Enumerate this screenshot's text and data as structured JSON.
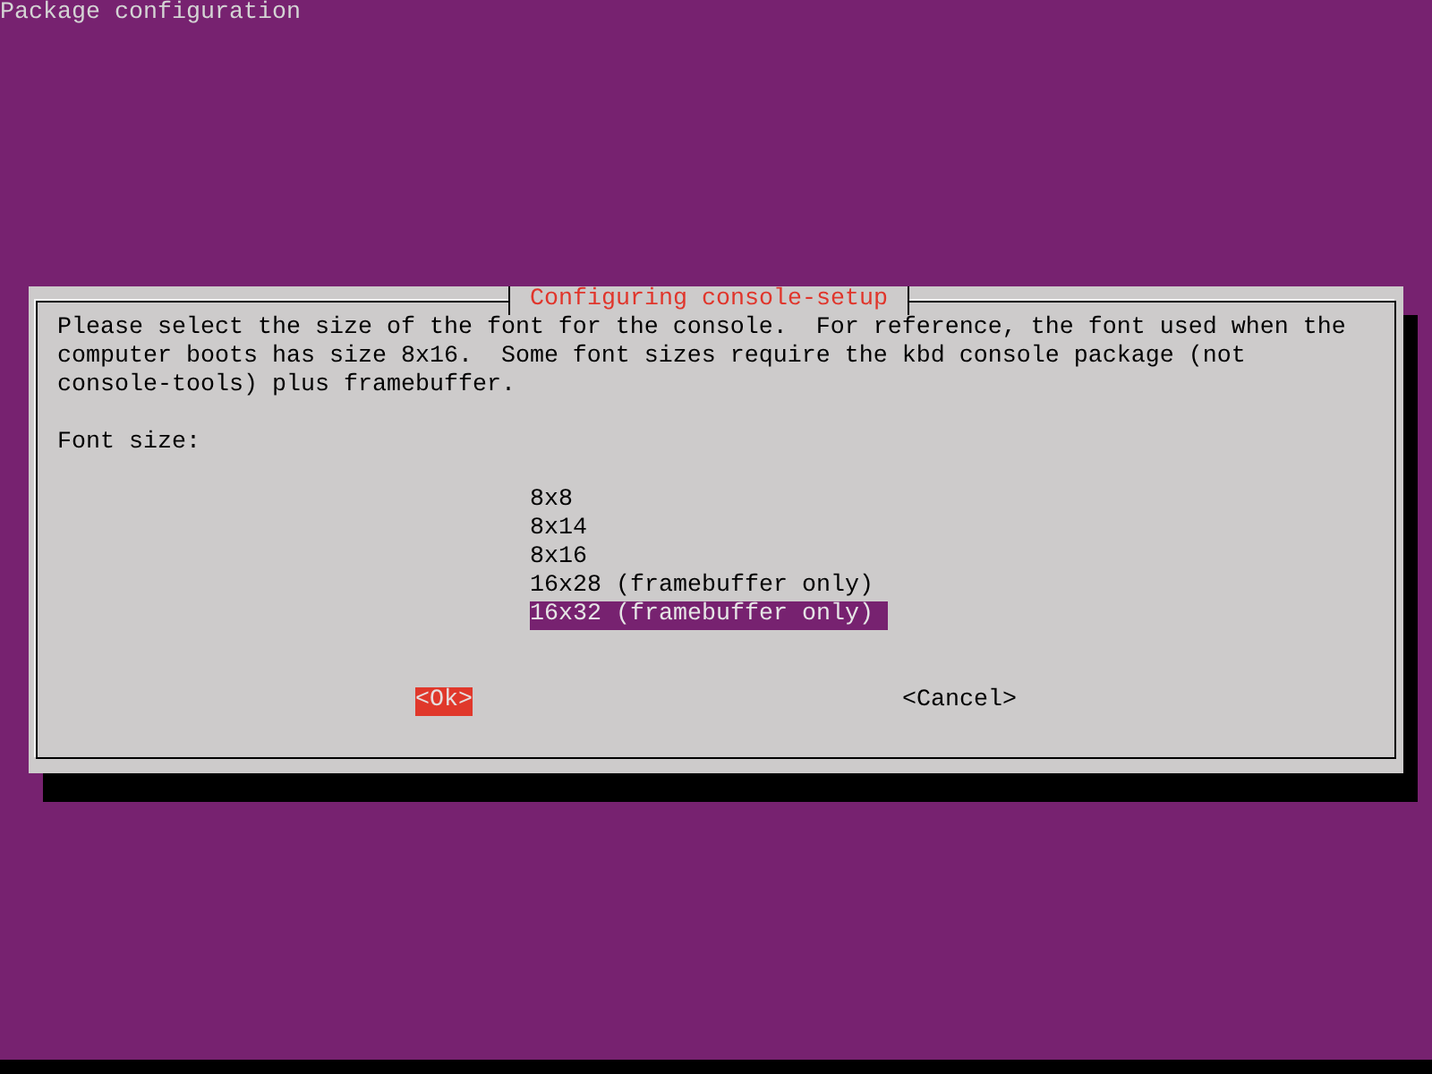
{
  "screen": {
    "title": "Package configuration"
  },
  "dialog": {
    "title": "Configuring console-setup",
    "description": "Please select the size of the font for the console.  For reference, the font used when the computer boots has size 8x16.  Some font sizes require the kbd console package (not console-tools) plus framebuffer.",
    "prompt": "Font size:",
    "options": [
      {
        "label": "8x8",
        "selected": false
      },
      {
        "label": "8x14",
        "selected": false
      },
      {
        "label": "8x16",
        "selected": false
      },
      {
        "label": "16x28 (framebuffer only)",
        "selected": false
      },
      {
        "label": "16x32 (framebuffer only)",
        "selected": true
      }
    ],
    "buttons": [
      {
        "label": "<Ok>",
        "selected": true
      },
      {
        "label": "<Cancel>",
        "selected": false
      }
    ]
  }
}
